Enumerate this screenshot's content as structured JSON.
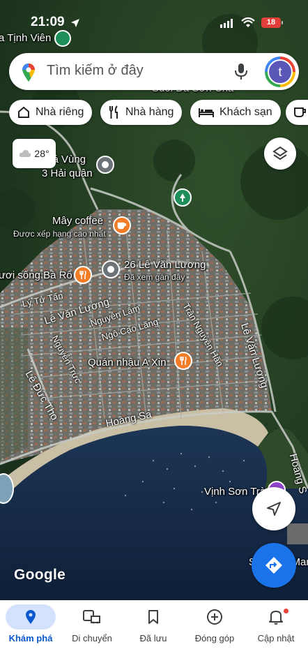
{
  "status_bar": {
    "time": "21:09",
    "battery": "18"
  },
  "search": {
    "placeholder": "Tìm kiếm ở đây",
    "avatar_letter": "t"
  },
  "chips": [
    {
      "label": "Nhà riêng",
      "icon": "home-icon"
    },
    {
      "label": "Nhà hàng",
      "icon": "fork-knife-icon"
    },
    {
      "label": "Khách sạn",
      "icon": "bed-icon"
    }
  ],
  "weather": {
    "temperature": "28°",
    "icon": "cloud-icon"
  },
  "map": {
    "places": {
      "tinh_vien": "a Tịnh Viên",
      "suoi_da": "Suối Đá Sơn Chà",
      "xa_vung_line1": "xá Vùng",
      "xa_vung_line2": "3 Hải quân",
      "may_coffee": "Mây coffee",
      "may_coffee_sub": "Được xếp hạng cao nhất",
      "ba_ro": "ươi sống Bà Rô",
      "address": "26 Lê Văn Lương",
      "address_sub": "Đã xem gần đây",
      "quan_nhau": "Quán nhậu A Xin",
      "vinh_son_tra": "Vịnh Sơn Trà",
      "son_tra_right": "Sơn Tr... Mari"
    },
    "roads": {
      "ly_tu_tan": "Lý Tử Tấn",
      "le_van_luong_left": "Lê Văn Lương",
      "nguyen_lam": "Nguyễn Lâm",
      "ngo_cao_lang": "Ngô Cao Lãng",
      "tran_nguyen_han": "Trần Nguyên Hãn",
      "le_van_luong_right": "Lê Văn Lương",
      "nguyen_truc": "Nguyễn Trực",
      "le_duc_tho": "Lê Đức Thọ",
      "hoang_sa": "Hoàng Sa",
      "hoang_sa_right": "Hoàng S"
    },
    "logo": "Google"
  },
  "bottom_nav": [
    {
      "label": "Khám phá",
      "icon": "explore-pin-icon",
      "active": true
    },
    {
      "label": "Di chuyển",
      "icon": "commute-icon",
      "active": false
    },
    {
      "label": "Đã lưu",
      "icon": "bookmark-icon",
      "active": false
    },
    {
      "label": "Đóng góp",
      "icon": "add-circle-icon",
      "active": false
    },
    {
      "label": "Cập nhật",
      "icon": "bell-icon",
      "active": false
    }
  ],
  "colors": {
    "accent": "#1a73e8",
    "poi_orange": "#f27d26",
    "poi_green": "#1e8e5a",
    "battery": "#e33f3a"
  }
}
